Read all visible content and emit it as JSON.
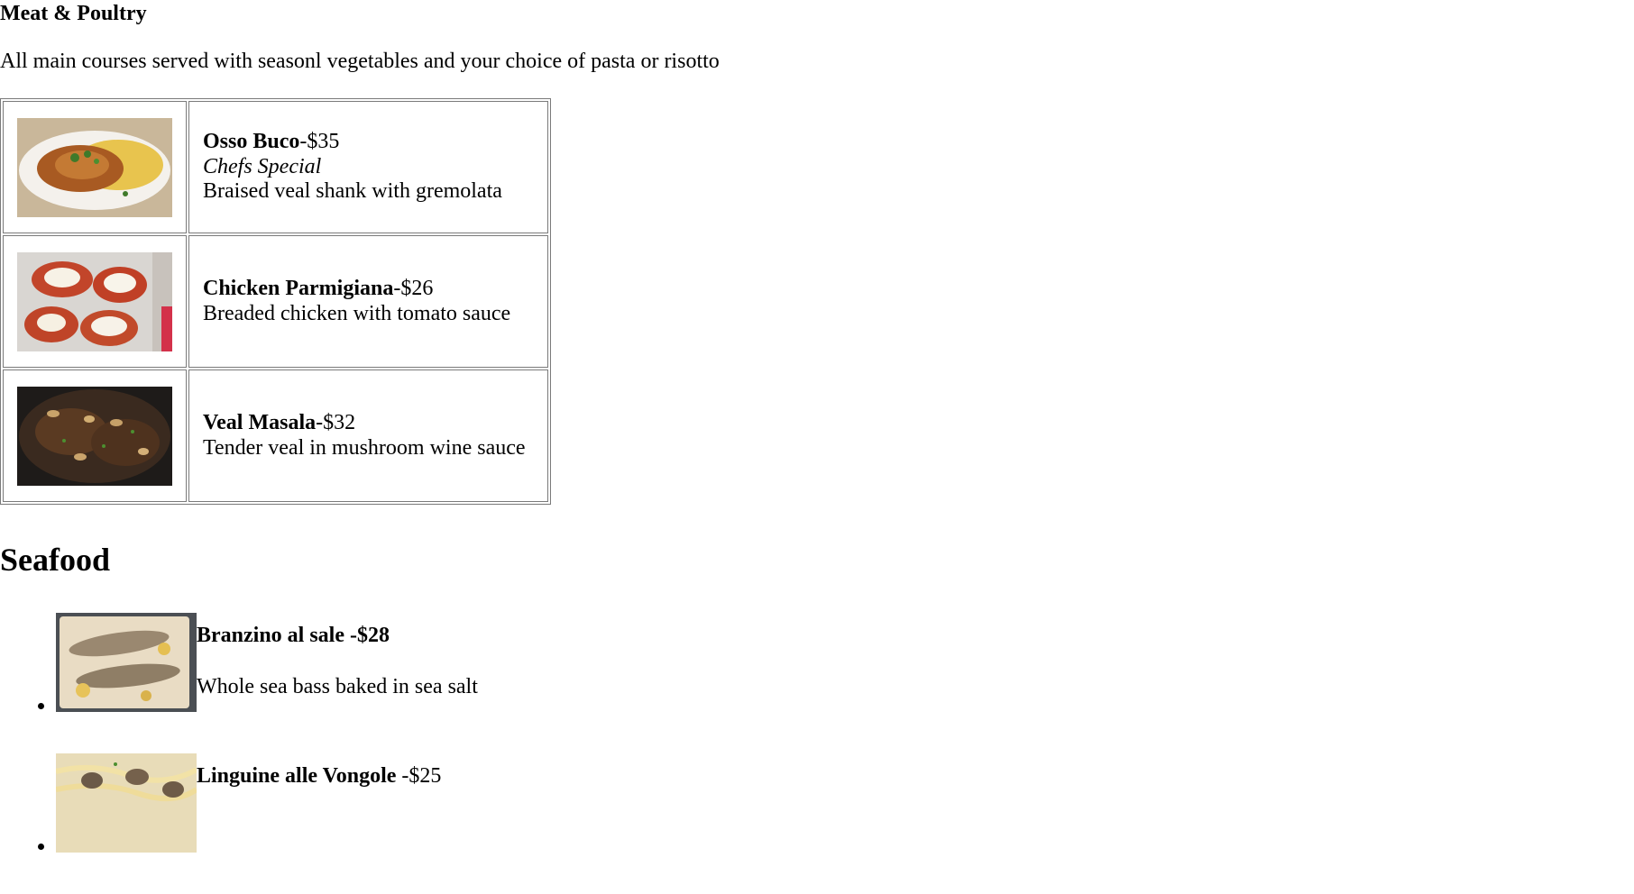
{
  "meat_section": {
    "heading": "Meat & Poultry",
    "intro": "All main courses served with seasonl vegetables and your choice of pasta or risotto",
    "dishes": [
      {
        "name": "Osso Buco",
        "price": "-$35",
        "special": "Chefs Special",
        "description": "Braised veal shank with gremolata",
        "image_icon": "osso-buco-photo"
      },
      {
        "name": "Chicken Parmigiana",
        "price": "-$26",
        "description": "Breaded chicken with tomato sauce",
        "image_icon": "chicken-parmigiana-photo"
      },
      {
        "name": "Veal Masala",
        "price": "-$32",
        "description": "Tender veal in mushroom wine sauce",
        "image_icon": "veal-masala-photo"
      }
    ]
  },
  "seafood_section": {
    "heading": "Seafood",
    "items": [
      {
        "name": "Branzino al sale -$28",
        "description": "Whole sea bass baked in sea salt",
        "image_icon": "branzino-photo"
      },
      {
        "name": "Linguine alle Vongole",
        "price": " -$25",
        "image_icon": "linguine-vongole-photo"
      }
    ]
  },
  "colors": {
    "border": "#7a7a7a",
    "text": "#000000",
    "background": "#ffffff"
  }
}
